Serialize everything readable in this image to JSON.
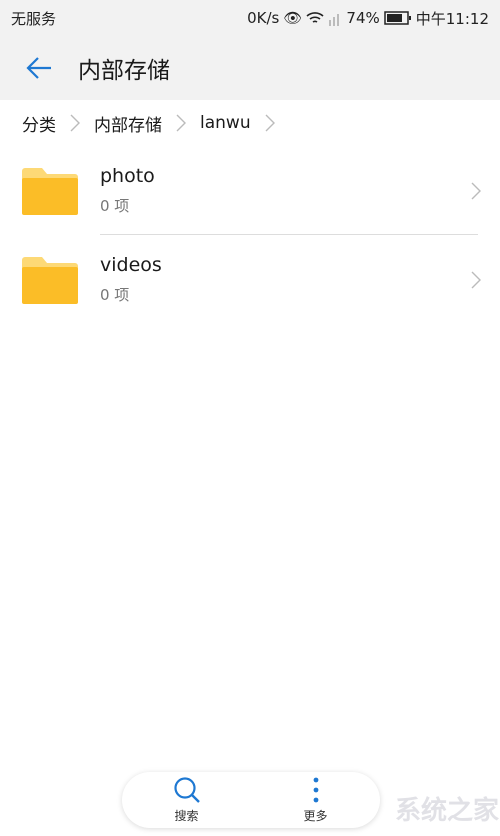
{
  "status_bar": {
    "carrier": "无服务",
    "speed": "0K/s",
    "battery": "74%",
    "time": "中午11:12"
  },
  "header": {
    "title": "内部存储",
    "back_icon": "arrow-left-icon"
  },
  "breadcrumb": [
    {
      "label": "分类"
    },
    {
      "label": "内部存储"
    },
    {
      "label": "lanwu"
    }
  ],
  "folders": [
    {
      "name": "photo",
      "count": "0 项"
    },
    {
      "name": "videos",
      "count": "0 项"
    }
  ],
  "bottom_bar": {
    "search_label": "搜索",
    "more_label": "更多"
  },
  "colors": {
    "accent": "#1e78d2",
    "folder": "#fbbd27"
  },
  "watermark": "系统之家"
}
